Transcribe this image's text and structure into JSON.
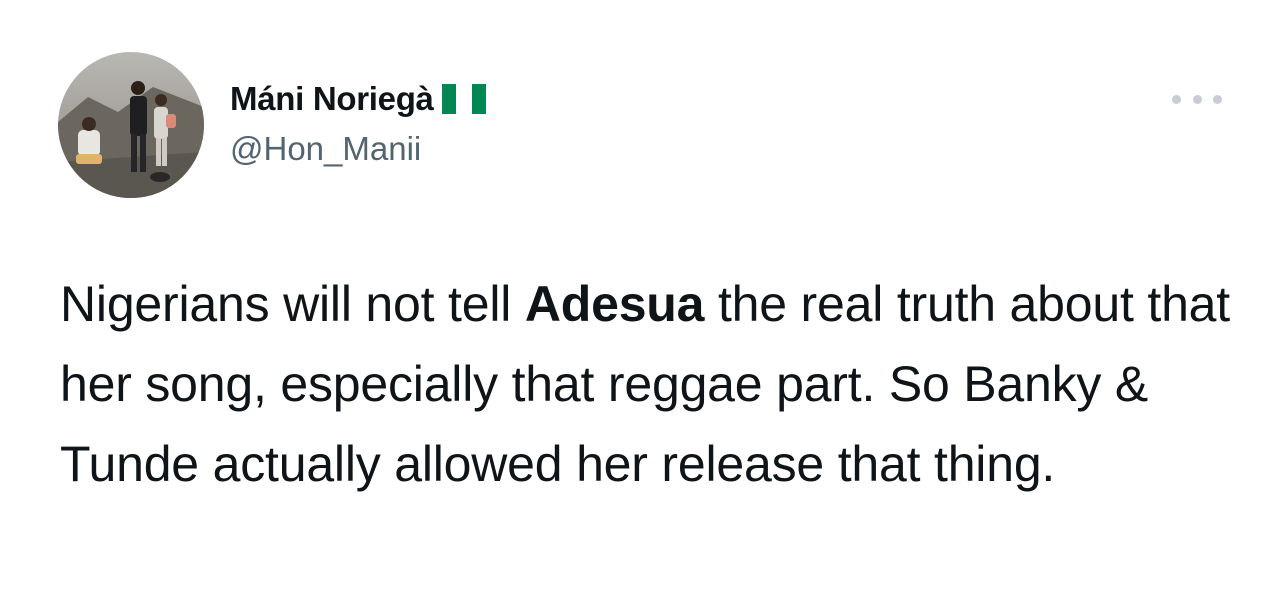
{
  "user": {
    "display_name": "Máni Noriegà",
    "flag": "nigeria-flag",
    "handle": "@Hon_Manii"
  },
  "tweet": {
    "text_before": "Nigerians will not tell ",
    "mention_bold": "Adesua",
    "text_after": " the real truth about that her song, especially that reggae part. So Banky & Tunde actually allowed her release that thing."
  },
  "icons": {
    "more": "more-options-icon"
  },
  "colors": {
    "text": "#0f1419",
    "secondary": "#536471",
    "more_dots": "#c7cdd2",
    "flag_green": "#008751",
    "flag_white": "#ffffff"
  }
}
